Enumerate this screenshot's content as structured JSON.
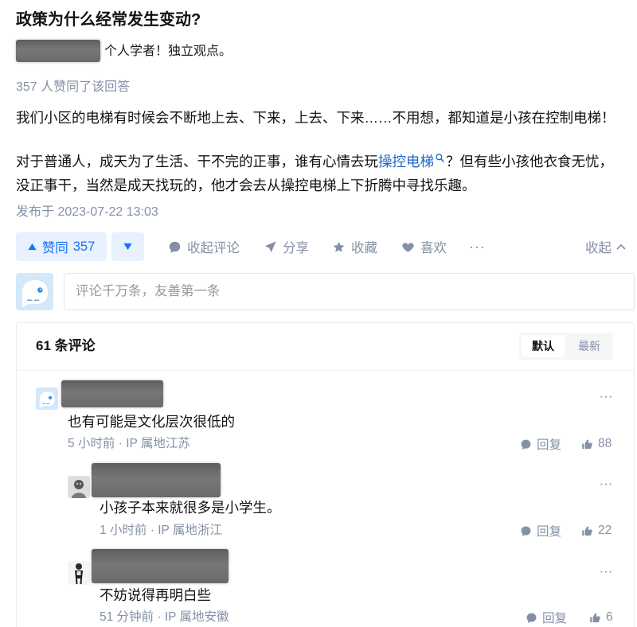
{
  "colors": {
    "brand_blue": "#1772f6",
    "upvote_bg": "#e8f1fe",
    "link_blue": "#1f64c8",
    "text_primary": "#121212",
    "text_secondary": "#8590a6",
    "border": "#ebebeb"
  },
  "question": {
    "title": "政策为什么经常发生变动?"
  },
  "author": {
    "headline": "个人学者！独立观点。"
  },
  "answer": {
    "voteup_text": "357 人赞同了该回答",
    "paragraph_1": "我们小区的电梯有时候会不断地上去、下来，上去、下来……不用想，都知道是小孩在控制电梯！",
    "paragraph_2": {
      "before": "对于普通人，成天为了生活、干不完的正事，谁有心情去玩",
      "keyword_link": "操控电梯",
      "keyword_icon": "search-icon",
      "after": "？但有些小孩他衣食无忧，没正事干，当然是成天找玩的，他才会去从操控电梯上下折腾中寻找乐趣。"
    },
    "published": "发布于 2023-07-22 13:03"
  },
  "action_bar": {
    "upvote": {
      "icon": "upvote-triangle-icon",
      "label": "赞同",
      "count": "357"
    },
    "downvote": {
      "icon": "downvote-triangle-icon"
    },
    "collapse_comments": {
      "icon": "comment-icon",
      "label": "收起评论"
    },
    "share": {
      "icon": "share-icon",
      "label": "分享"
    },
    "favorite": {
      "icon": "star-icon",
      "label": "收藏"
    },
    "like": {
      "icon": "heart-icon",
      "label": "喜欢"
    },
    "more": "···",
    "collapse": {
      "label": "收起",
      "icon": "chevron-up-icon"
    }
  },
  "comment_editor": {
    "placeholder": "评论千万条，友善第一条",
    "value": ""
  },
  "comments": {
    "count_label": "61 条评论",
    "sort_options": [
      "默认",
      "最新"
    ],
    "selected_sort": "默认",
    "meta_separator": " · ",
    "more_label": "···",
    "reply_label": "回复",
    "items": [
      {
        "text": "也有可能是文化层次很低的",
        "time": "5 小时前",
        "ip_location": "IP 属地江苏",
        "likes": "88",
        "replies": [
          {
            "text": "小孩子本来就很多是小学生。",
            "time": "1 小时前",
            "ip_location": "IP 属地浙江",
            "likes": "22"
          },
          {
            "text": "不妨说得再明白些",
            "time": "51 分钟前",
            "ip_location": "IP 属地安徽",
            "likes": "6"
          }
        ]
      }
    ]
  }
}
